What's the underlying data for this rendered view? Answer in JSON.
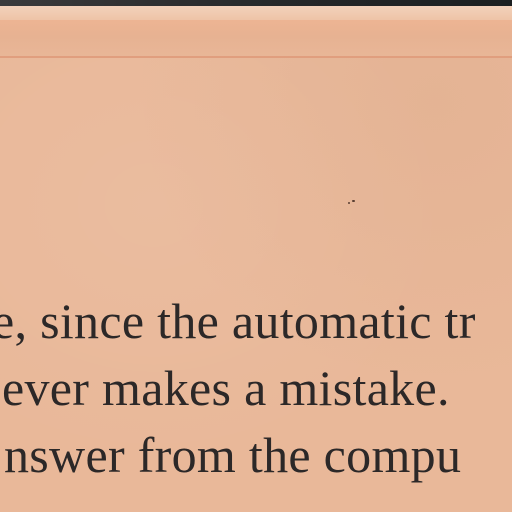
{
  "document": {
    "lines": [
      "e, since the automatic tr",
      "ever makes a mistake.",
      "nswer from the compu",
      "             "
    ]
  }
}
